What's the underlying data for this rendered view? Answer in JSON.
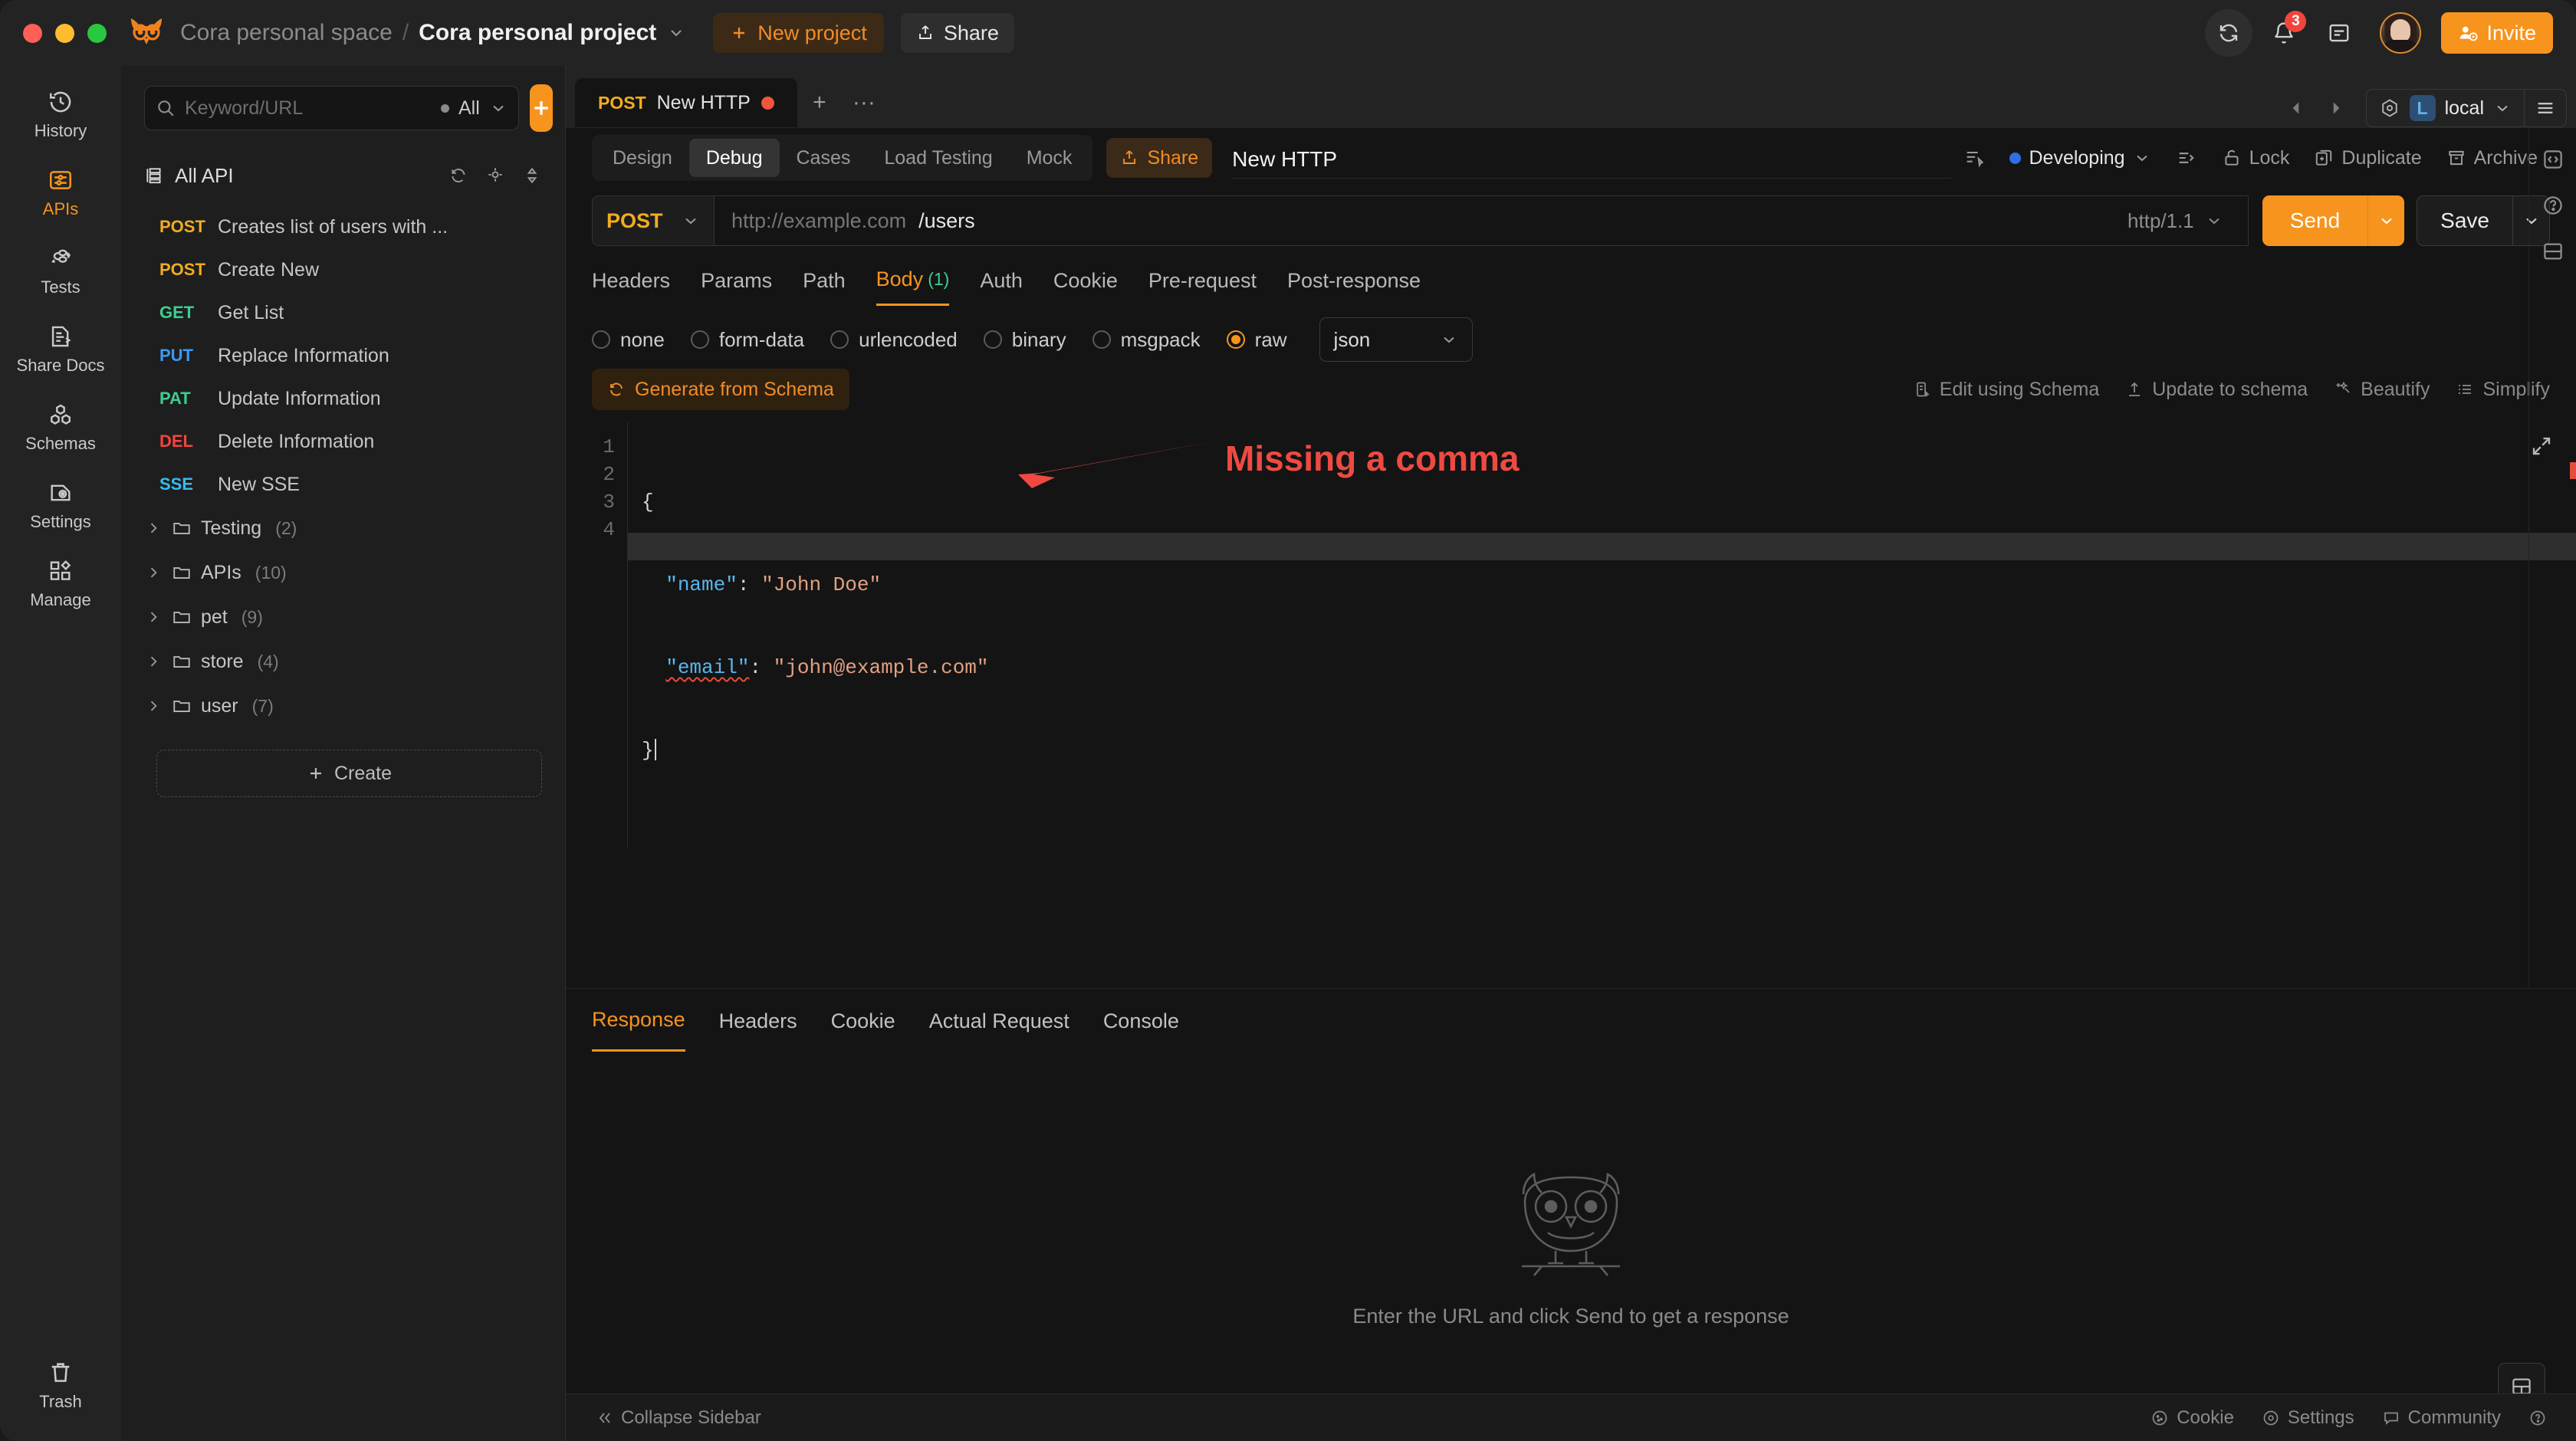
{
  "titlebar": {
    "space": "Cora personal space",
    "separator": "/",
    "project": "Cora personal project",
    "new_project": "New project",
    "share": "Share",
    "notification_count": "3",
    "invite": "Invite"
  },
  "rail": {
    "items": [
      {
        "label": "History",
        "icon": "history-icon",
        "active": false
      },
      {
        "label": "APIs",
        "icon": "apis-icon",
        "active": true
      },
      {
        "label": "Tests",
        "icon": "tests-icon",
        "active": false
      },
      {
        "label": "Share Docs",
        "icon": "share-docs-icon",
        "active": false
      },
      {
        "label": "Schemas",
        "icon": "schemas-icon",
        "active": false
      },
      {
        "label": "Settings",
        "icon": "settings-icon",
        "active": false
      },
      {
        "label": "Manage",
        "icon": "manage-icon",
        "active": false
      }
    ],
    "trash": "Trash"
  },
  "sidebar": {
    "search_placeholder": "Keyword/URL",
    "search_value": "",
    "scope": "All",
    "add_button": "+",
    "tree_title": "All API",
    "apis": [
      {
        "method": "POST",
        "method_class": "m-post",
        "name": "Creates list of users with ..."
      },
      {
        "method": "POST",
        "method_class": "m-post",
        "name": "Create New"
      },
      {
        "method": "GET",
        "method_class": "m-get",
        "name": "Get List"
      },
      {
        "method": "PUT",
        "method_class": "m-put",
        "name": "Replace Information"
      },
      {
        "method": "PAT",
        "method_class": "m-patch",
        "name": "Update Information"
      },
      {
        "method": "DEL",
        "method_class": "m-del",
        "name": "Delete Information"
      },
      {
        "method": "SSE",
        "method_class": "m-sse",
        "name": "New SSE"
      }
    ],
    "folders": [
      {
        "name": "Testing",
        "count": "(2)"
      },
      {
        "name": "APIs",
        "count": "(10)"
      },
      {
        "name": "pet",
        "count": "(9)"
      },
      {
        "name": "store",
        "count": "(4)"
      },
      {
        "name": "user",
        "count": "(7)"
      }
    ],
    "create": "Create"
  },
  "tabbar": {
    "open_tab": {
      "method": "POST",
      "title": "New HTTP",
      "unsaved": true
    },
    "add": "+",
    "more": "···",
    "environment": {
      "letter": "L",
      "name": "local"
    }
  },
  "api_header": {
    "segments": [
      "Design",
      "Debug",
      "Cases",
      "Load Testing",
      "Mock"
    ],
    "active_segment": "Debug",
    "share": "Share",
    "title": "New HTTP",
    "status": "Developing",
    "status_color": "#2f6fe0",
    "tools": [
      "Lock",
      "Duplicate",
      "Archive"
    ]
  },
  "request": {
    "method": "POST",
    "url_host": "http://example.com",
    "url_path": "/users",
    "protocol": "http/1.1",
    "send": "Send",
    "save": "Save",
    "tabs": [
      {
        "label": "Headers",
        "count": ""
      },
      {
        "label": "Params",
        "count": ""
      },
      {
        "label": "Path",
        "count": ""
      },
      {
        "label": "Body",
        "count": "(1)"
      },
      {
        "label": "Auth",
        "count": ""
      },
      {
        "label": "Cookie",
        "count": ""
      },
      {
        "label": "Pre-request",
        "count": ""
      },
      {
        "label": "Post-response",
        "count": ""
      }
    ],
    "active_tab": "Body",
    "body_types": [
      "none",
      "form-data",
      "urlencoded",
      "binary",
      "msgpack",
      "raw"
    ],
    "body_type_selected": "raw",
    "raw_format": "json",
    "generate_from_schema": "Generate from Schema",
    "editor_actions": [
      "Edit using Schema",
      "Update to schema",
      "Beautify",
      "Simplify"
    ]
  },
  "code": {
    "line_numbers": [
      "1",
      "2",
      "3",
      "4"
    ],
    "lines": [
      "{",
      "  \"name\": \"John Doe\"",
      "  \"email\": \"john@example.com\"",
      "}"
    ],
    "error_underline_token": "\"email\"",
    "language": "json"
  },
  "annotation": {
    "text": "Missing a comma",
    "color": "#ef4a42",
    "arrow": "left-pointing-arrow"
  },
  "response": {
    "tabs": [
      "Response",
      "Headers",
      "Cookie",
      "Actual Request",
      "Console"
    ],
    "active_tab": "Response",
    "empty_message": "Enter the URL and click Send to get a response"
  },
  "statusbar": {
    "collapse_sidebar": "Collapse Sidebar",
    "items": [
      "Cookie",
      "Settings",
      "Community"
    ]
  }
}
